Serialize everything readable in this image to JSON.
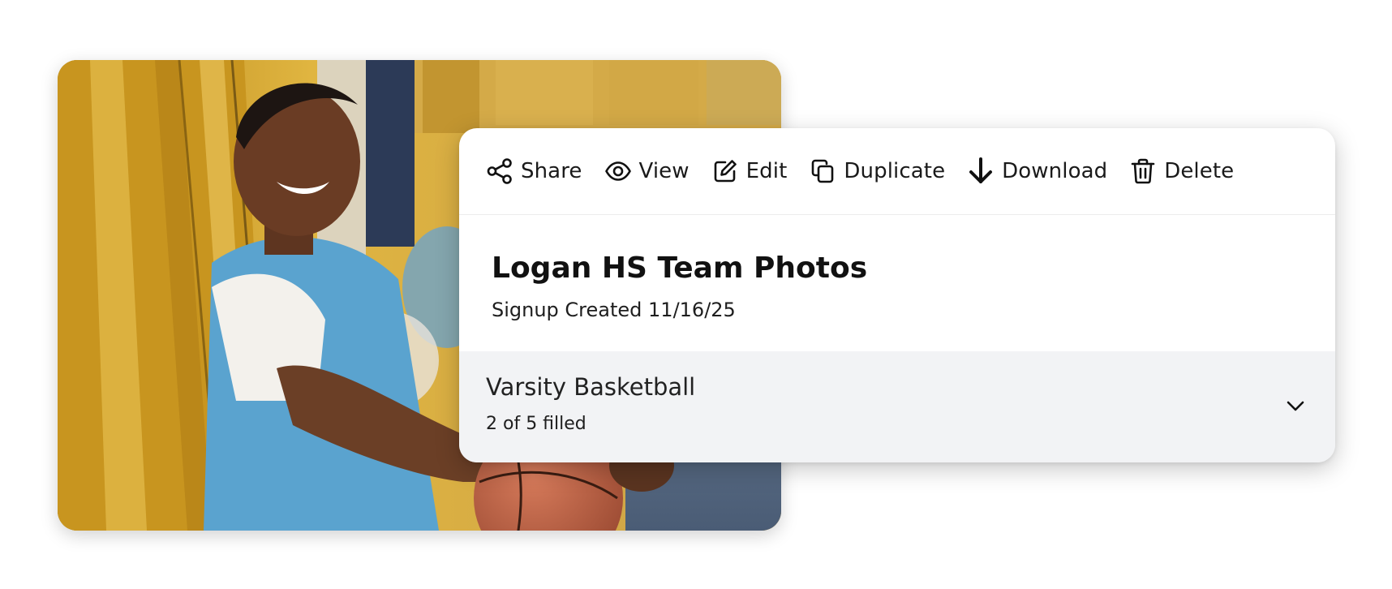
{
  "toolbar": {
    "actions": [
      {
        "label": "Share",
        "icon": "share-icon"
      },
      {
        "label": "View",
        "icon": "eye-icon"
      },
      {
        "label": "Edit",
        "icon": "edit-icon"
      },
      {
        "label": "Duplicate",
        "icon": "duplicate-icon"
      },
      {
        "label": "Download",
        "icon": "download-icon"
      },
      {
        "label": "Delete",
        "icon": "trash-icon"
      }
    ]
  },
  "signup": {
    "title": "Logan HS Team Photos",
    "created": "Signup Created 11/16/25"
  },
  "group": {
    "name": "Varsity Basketball",
    "filled": "2 of 5 filled",
    "toggle_icon": "chevron-down-icon"
  },
  "colors": {
    "row_background": "#f2f3f5",
    "text": "#111111",
    "locker_yellow": "#d4a52c",
    "jersey_blue": "#5aa3cf"
  }
}
